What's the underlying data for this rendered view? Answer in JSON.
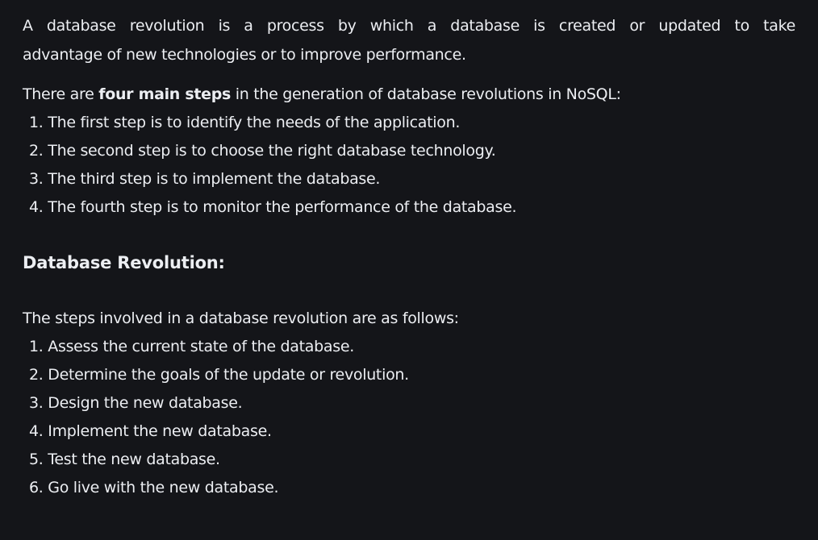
{
  "intro": {
    "line1": "A database revolution is a process by which a database is created or updated to take",
    "line2": "advantage of new technologies or to improve performance."
  },
  "steps_intro": {
    "prefix": "There are ",
    "bold": "four main steps",
    "suffix": " in the generation of database revolutions in NoSQL:"
  },
  "generation_steps": [
    "1. The first step is to identify the needs of the application.",
    "2. The second step is to choose the right database technology.",
    "3. The third step is to implement the database.",
    "4. The fourth step is to monitor the performance of the database."
  ],
  "heading": "Database Revolution:",
  "revolution_intro": "The steps involved in a database revolution are as follows:",
  "revolution_steps": [
    "1. Assess the current state of the database.",
    "2. Determine the goals of the update or revolution.",
    "3. Design the new database.",
    "4. Implement the new database.",
    "5. Test the new database.",
    "6. Go live with the new database."
  ],
  "colors": {
    "background": "#141519",
    "text": "#eceef2"
  }
}
